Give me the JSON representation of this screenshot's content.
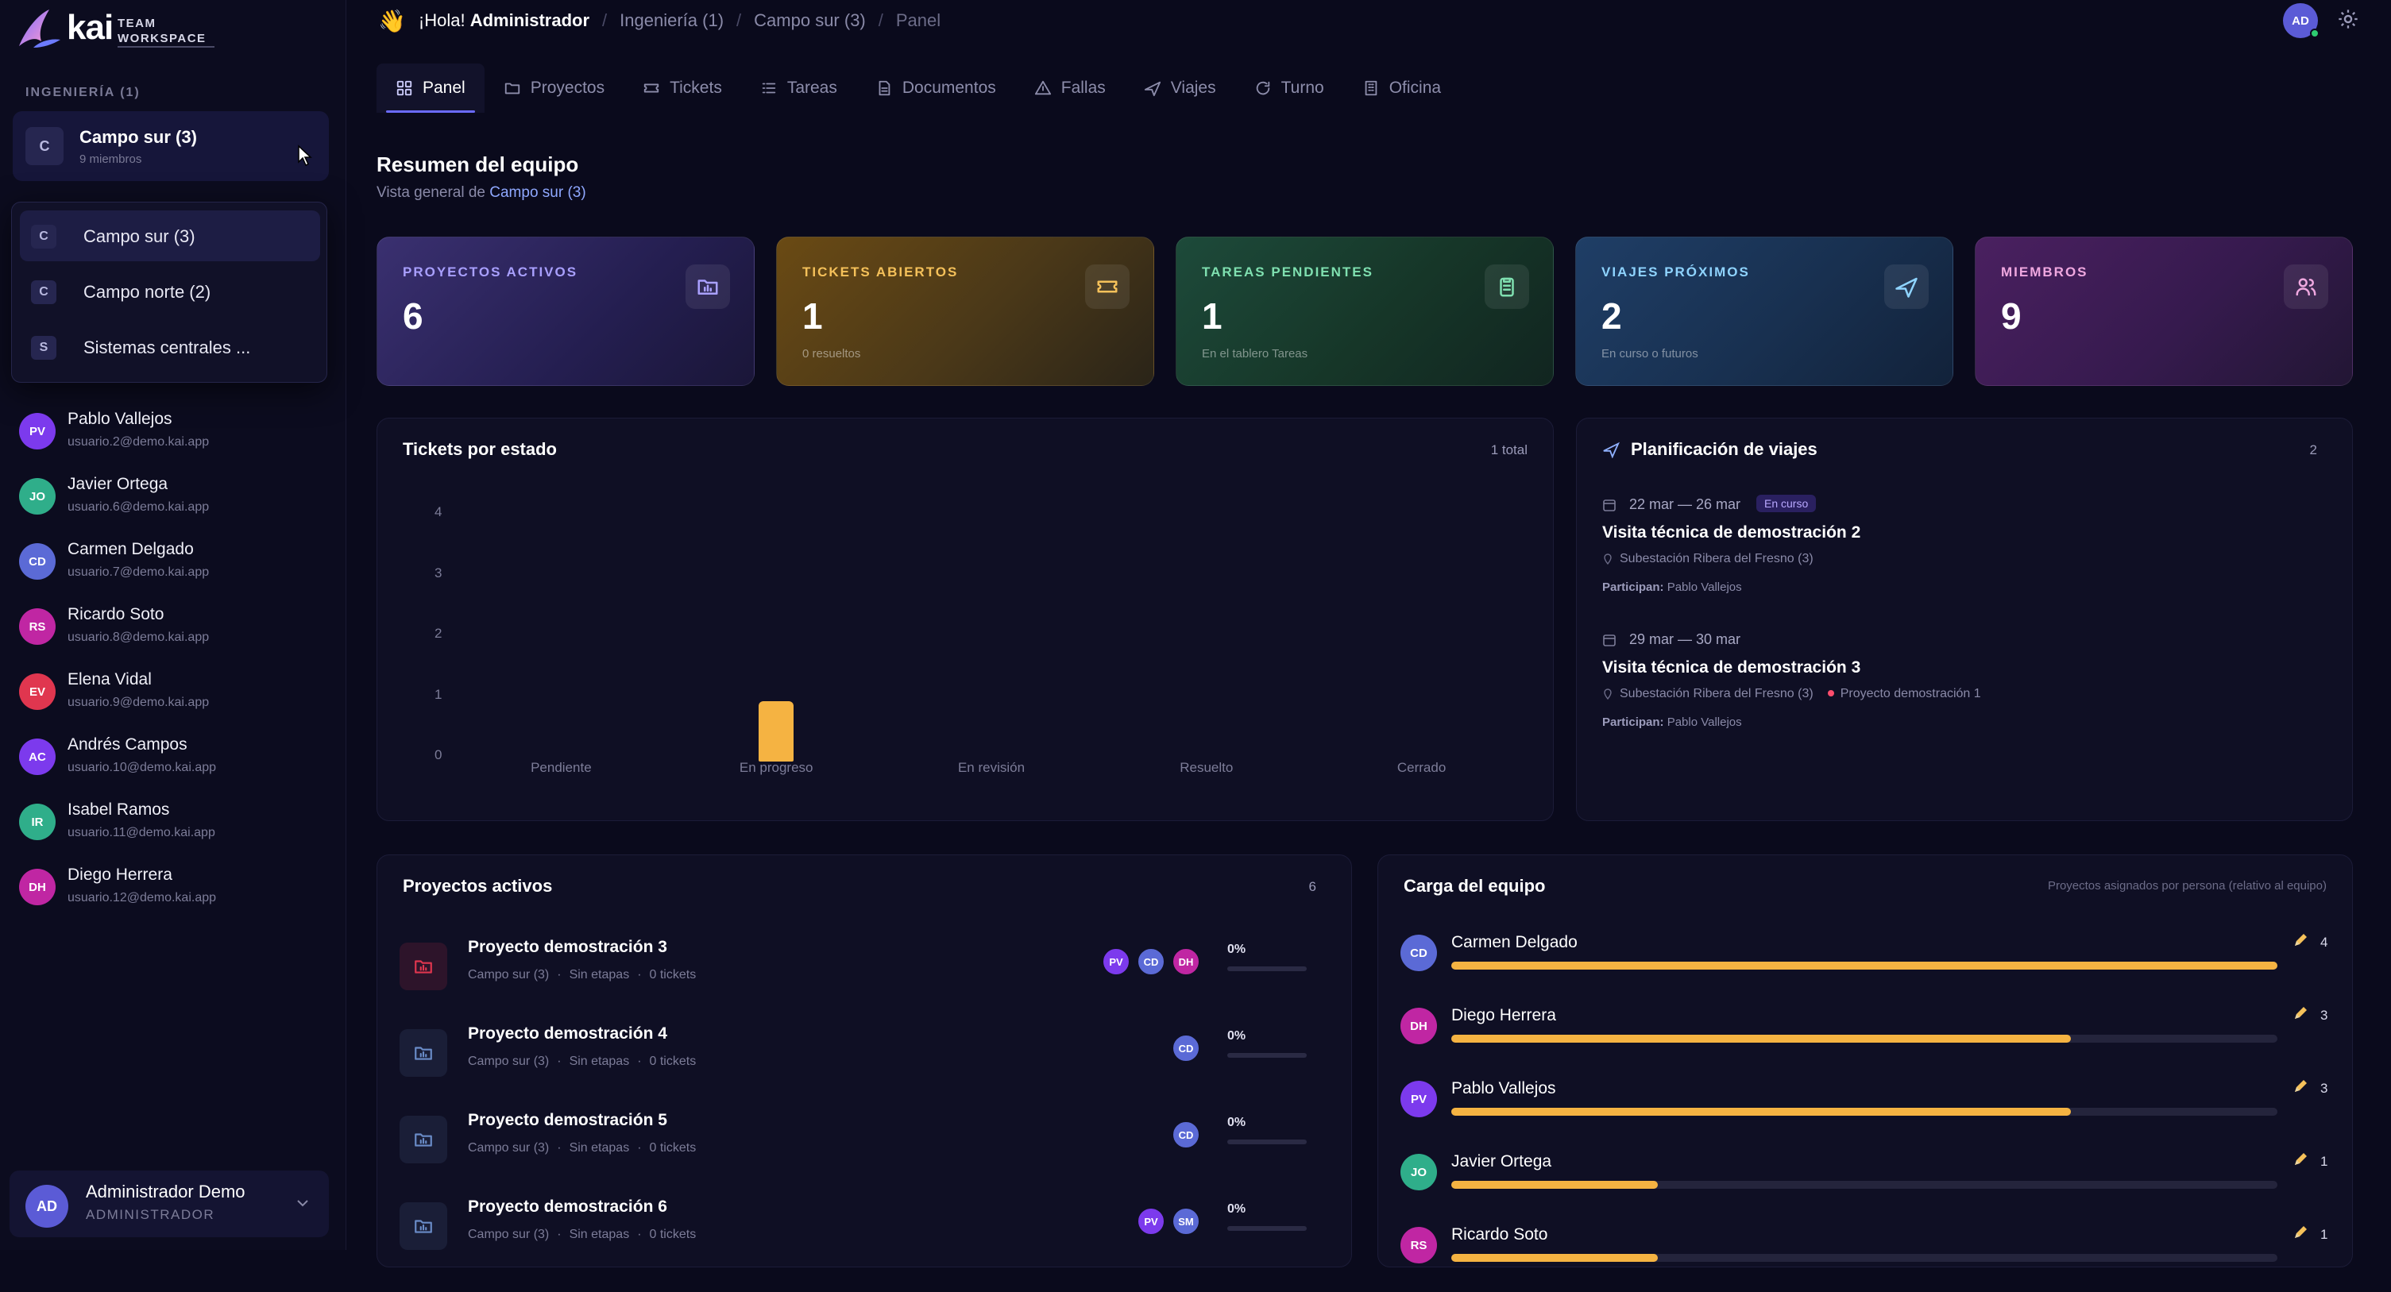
{
  "brand": {
    "name": "kai",
    "sub_line1": "TEAM",
    "sub_line2": "WORKSPACE"
  },
  "sidebar": {
    "section_label": "INGENIERÍA (1)",
    "workspace": {
      "initial": "C",
      "name": "Campo sur (3)",
      "members": "9 miembros"
    },
    "dropdown": [
      {
        "initial": "C",
        "name": "Campo sur (3)",
        "selected": true
      },
      {
        "initial": "C",
        "name": "Campo norte (2)",
        "selected": false
      },
      {
        "initial": "S",
        "name": "Sistemas centrales ...",
        "selected": false
      }
    ],
    "members": [
      {
        "initials": "PV",
        "name": "Pablo Vallejos",
        "email": "usuario.2@demo.kai.app",
        "color": "#7c3aed"
      },
      {
        "initials": "JO",
        "name": "Javier Ortega",
        "email": "usuario.6@demo.kai.app",
        "color": "#2fae8a"
      },
      {
        "initials": "CD",
        "name": "Carmen Delgado",
        "email": "usuario.7@demo.kai.app",
        "color": "#5b6ad6"
      },
      {
        "initials": "RS",
        "name": "Ricardo Soto",
        "email": "usuario.8@demo.kai.app",
        "color": "#c026a3"
      },
      {
        "initials": "EV",
        "name": "Elena Vidal",
        "email": "usuario.9@demo.kai.app",
        "color": "#e0364f"
      },
      {
        "initials": "AC",
        "name": "Andrés Campos",
        "email": "usuario.10@demo.kai.app",
        "color": "#7c3aed"
      },
      {
        "initials": "IR",
        "name": "Isabel Ramos",
        "email": "usuario.11@demo.kai.app",
        "color": "#2fae8a"
      },
      {
        "initials": "DH",
        "name": "Diego Herrera",
        "email": "usuario.12@demo.kai.app",
        "color": "#c026a3"
      }
    ],
    "user": {
      "initials": "AD",
      "name": "Administrador Demo",
      "role": "ADMINISTRADOR"
    }
  },
  "header": {
    "greeting_emoji": "👋",
    "greeting": "¡Hola!",
    "user_name": "Administrador",
    "crumbs": [
      "Ingeniería (1)",
      "Campo sur (3)",
      "Panel"
    ],
    "avatar": "AD"
  },
  "tabs": [
    {
      "label": "Panel",
      "icon": "grid-icon",
      "active": true
    },
    {
      "label": "Proyectos",
      "icon": "folder-icon",
      "active": false
    },
    {
      "label": "Tickets",
      "icon": "ticket-icon",
      "active": false
    },
    {
      "label": "Tareas",
      "icon": "list-icon",
      "active": false
    },
    {
      "label": "Documentos",
      "icon": "document-icon",
      "active": false
    },
    {
      "label": "Fallas",
      "icon": "warning-icon",
      "active": false
    },
    {
      "label": "Viajes",
      "icon": "plane-icon",
      "active": false
    },
    {
      "label": "Turno",
      "icon": "refresh-icon",
      "active": false
    },
    {
      "label": "Oficina",
      "icon": "building-icon",
      "active": false
    }
  ],
  "summary": {
    "title": "Resumen del equipo",
    "subtitle_prefix": "Vista general de",
    "subtitle_link": "Campo sur (3)"
  },
  "stats": [
    {
      "label": "PROYECTOS ACTIVOS",
      "value": "6",
      "caption": "",
      "icon": "folder-chart-icon",
      "accent": "#a9a0ff"
    },
    {
      "label": "TICKETS ABIERTOS",
      "value": "1",
      "caption": "0 resueltos",
      "icon": "ticket-icon",
      "accent": "#f5c15a"
    },
    {
      "label": "TAREAS PENDIENTES",
      "value": "1",
      "caption": "En el tablero Tareas",
      "icon": "clipboard-icon",
      "accent": "#7fe0b0"
    },
    {
      "label": "VIAJES PRÓXIMOS",
      "value": "2",
      "caption": "En curso o futuros",
      "icon": "plane-icon",
      "accent": "#8fd4ff"
    },
    {
      "label": "MIEMBROS",
      "value": "9",
      "caption": "",
      "icon": "users-icon",
      "accent": "#f0a8e0"
    }
  ],
  "tickets_panel": {
    "title": "Tickets por estado",
    "count": "1 total"
  },
  "chart_data": {
    "type": "bar",
    "title": "Tickets por estado",
    "categories": [
      "Pendiente",
      "En progreso",
      "En revisión",
      "Resuelto",
      "Cerrado"
    ],
    "values": [
      0,
      1,
      0,
      0,
      0
    ],
    "yticks": [
      "0",
      "1",
      "2",
      "3",
      "4"
    ],
    "ylim": [
      0,
      4
    ],
    "color": "#f5b342"
  },
  "trips_panel": {
    "title": "Planificación de viajes",
    "count": "2",
    "trips": [
      {
        "dates": "22 mar — 26 mar",
        "badge": "En curso",
        "title": "Visita técnica de demostración 2",
        "location": "Subestación Ribera del Fresno (3)",
        "project": "",
        "participants_label": "Participan:",
        "participants": "Pablo Vallejos"
      },
      {
        "dates": "29 mar — 30 mar",
        "badge": "",
        "title": "Visita técnica de demostración 3",
        "location": "Subestación Ribera del Fresno (3)",
        "project": "Proyecto demostración 1",
        "participants_label": "Participan:",
        "participants": "Pablo Vallejos"
      }
    ]
  },
  "projects_panel": {
    "title": "Proyectos activos",
    "count": "6",
    "projects": [
      {
        "name": "Proyecto demostración 3",
        "campo": "Campo sur (3)",
        "etapas": "Sin etapas",
        "tickets": "0 tickets",
        "progress": "0%",
        "avatars": [
          "PV",
          "CD",
          "DH"
        ],
        "icon_color": "#e0364f"
      },
      {
        "name": "Proyecto demostración 4",
        "campo": "Campo sur (3)",
        "etapas": "Sin etapas",
        "tickets": "0 tickets",
        "progress": "0%",
        "avatars": [
          "CD"
        ],
        "icon_color": "#6a8cc8"
      },
      {
        "name": "Proyecto demostración 5",
        "campo": "Campo sur (3)",
        "etapas": "Sin etapas",
        "tickets": "0 tickets",
        "progress": "0%",
        "avatars": [
          "CD"
        ],
        "icon_color": "#6a8cc8"
      },
      {
        "name": "Proyecto demostración 6",
        "campo": "Campo sur (3)",
        "etapas": "Sin etapas",
        "tickets": "0 tickets",
        "progress": "0%",
        "avatars": [
          "PV",
          "SM"
        ],
        "icon_color": "#6a8cc8"
      }
    ]
  },
  "load_panel": {
    "title": "Carga del equipo",
    "note": "Proyectos asignados por persona (relativo al equipo)",
    "people": [
      {
        "initials": "CD",
        "name": "Carmen Delgado",
        "count": "4",
        "fraction": 1.0,
        "color": "#5b6ad6"
      },
      {
        "initials": "DH",
        "name": "Diego Herrera",
        "count": "3",
        "fraction": 0.75,
        "color": "#c026a3"
      },
      {
        "initials": "PV",
        "name": "Pablo Vallejos",
        "count": "3",
        "fraction": 0.75,
        "color": "#7c3aed"
      },
      {
        "initials": "JO",
        "name": "Javier Ortega",
        "count": "1",
        "fraction": 0.25,
        "color": "#2fae8a"
      },
      {
        "initials": "RS",
        "name": "Ricardo Soto",
        "count": "1",
        "fraction": 0.25,
        "color": "#c026a3"
      }
    ]
  },
  "avatar_colors": {
    "PV": "#7c3aed",
    "CD": "#5b6ad6",
    "DH": "#c026a3",
    "SM": "#5b6ad6"
  }
}
